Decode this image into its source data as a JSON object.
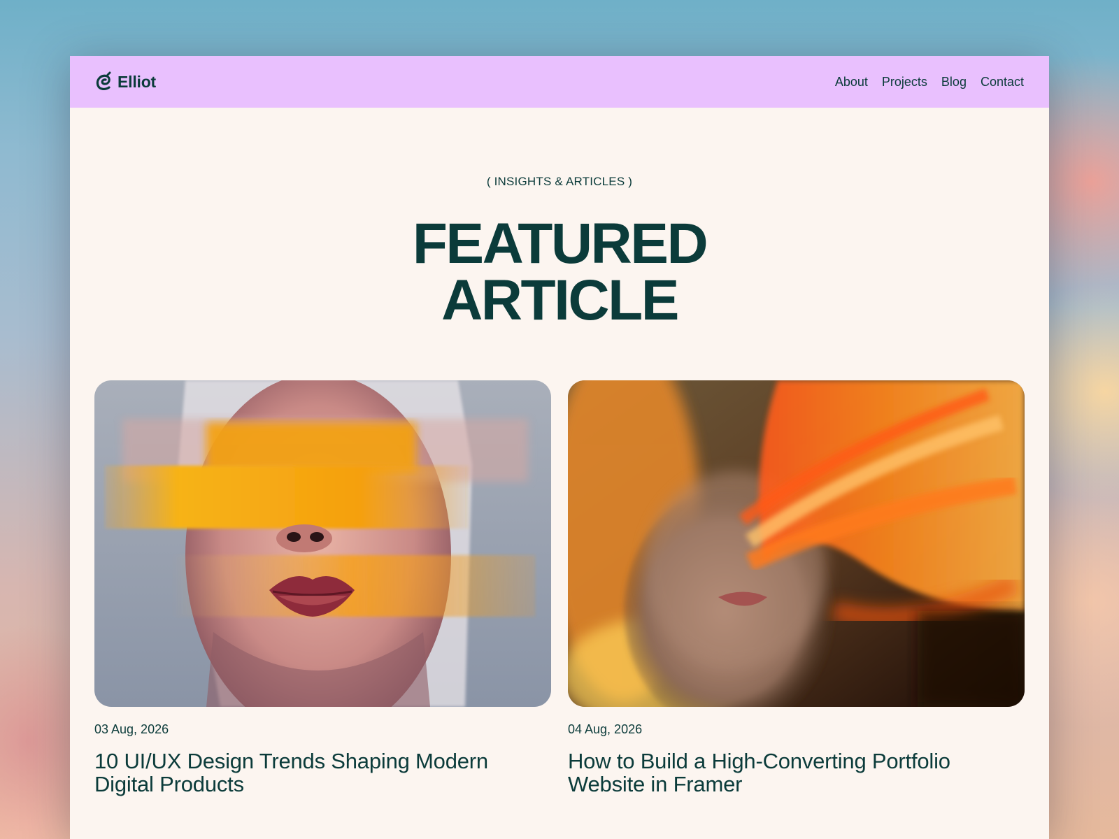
{
  "site": {
    "logo_text": "Elliot",
    "brand_color": "#e9c0fe",
    "text_color": "#0b3b3a",
    "background_color": "#fcf5f0"
  },
  "nav": {
    "items": [
      {
        "label": "About"
      },
      {
        "label": "Projects"
      },
      {
        "label": "Blog"
      },
      {
        "label": "Contact"
      }
    ]
  },
  "hero": {
    "kicker": "( INSIGHTS & ARTICLES )",
    "title_line1": "FEATURED",
    "title_line2": "ARTICLE"
  },
  "articles": [
    {
      "date": "03 Aug, 2026",
      "title": "10 UI/UX Design Trends Shaping Modern Digital Products",
      "image": "portrait-yellow-glitch-stripes"
    },
    {
      "date": "04 Aug, 2026",
      "title": "How to Build a High-Converting Portfolio Website in Framer",
      "image": "portrait-orange-light-streaks"
    }
  ]
}
